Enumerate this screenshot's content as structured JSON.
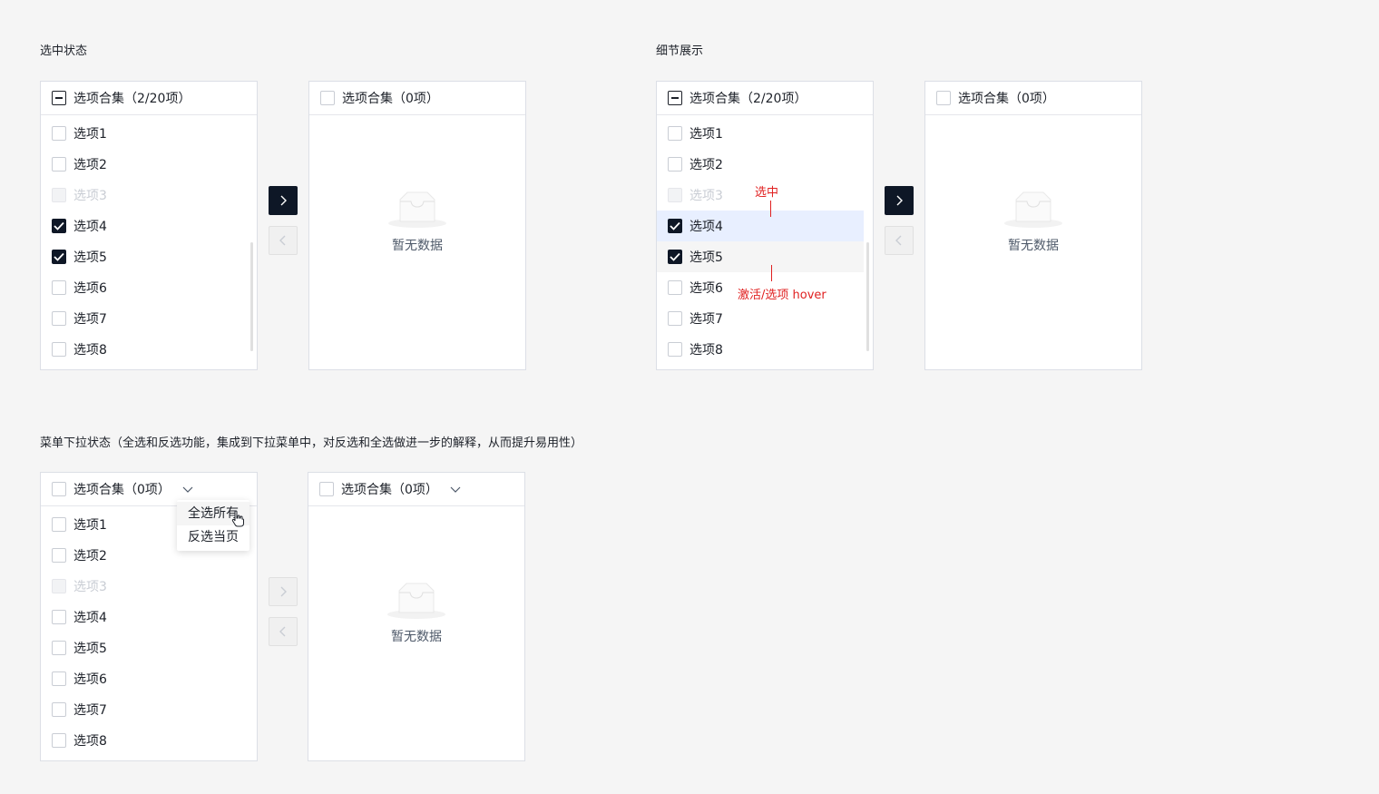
{
  "sections": {
    "selected_state": "选中状态",
    "detail_display": "细节展示",
    "dropdown_state": "菜单下拉状态（全选和反选功能，集成到下拉菜单中，对反选和全选做进一步的解释，从而提升易用性）"
  },
  "source_header": "选项合集（2/20项）",
  "target_header": "选项合集（0项）",
  "empty_text": "暂无数据",
  "items": [
    "选项1",
    "选项2",
    "选项3",
    "选项4",
    "选项5",
    "选项6",
    "选项7",
    "选项8"
  ],
  "checked_items": [
    "选项4",
    "选项5"
  ],
  "disabled_items": [
    "选项3"
  ],
  "dropdown_menu": {
    "select_all": "全选所有",
    "invert_page": "反选当页"
  },
  "annotations": {
    "selected": "选中",
    "hover": "激活/选项 hover"
  },
  "icons": {
    "move_right": "chevron-right-icon",
    "move_left": "chevron-left-icon",
    "dropdown": "chevron-down-icon",
    "empty": "inbox-icon",
    "cursor": "hand-pointer-icon"
  },
  "colors": {
    "primary": "#0e1726",
    "selected_bg": "#e8efff",
    "hover_bg": "#f5f5f5",
    "annotation": "#e02020",
    "disabled_text": "#c9cdd4"
  }
}
